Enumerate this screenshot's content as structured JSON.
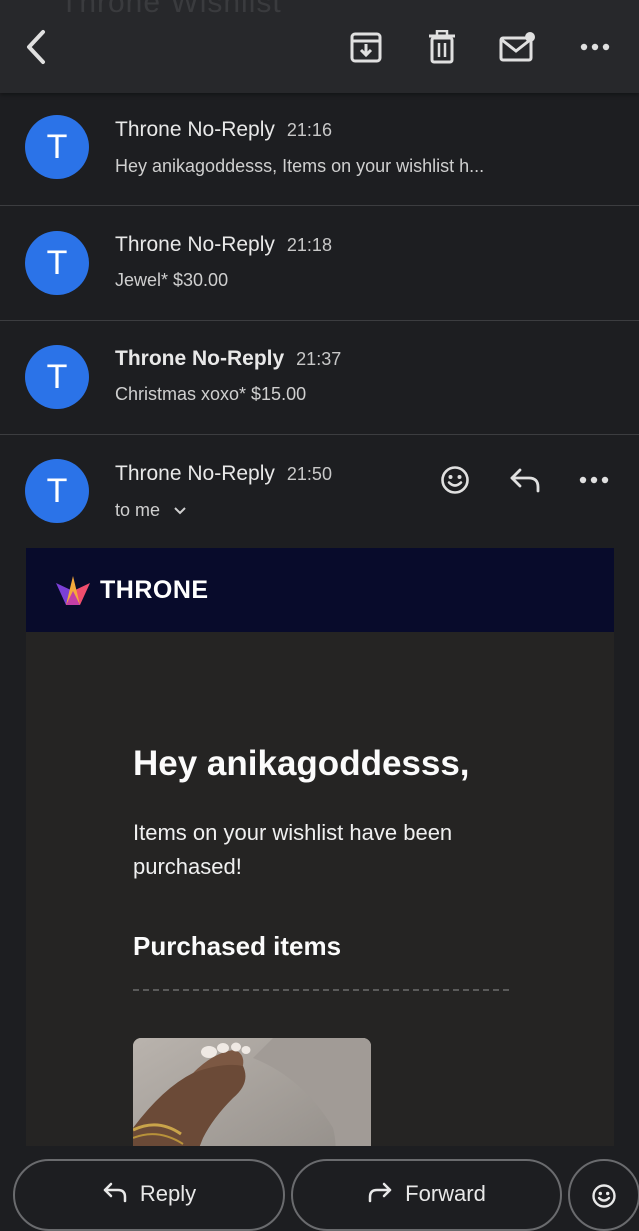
{
  "toolbar": {
    "ghost_text": "Throne Wishlist",
    "back_icon": "chevron-left-icon",
    "archive_icon": "archive-icon",
    "delete_icon": "trash-icon",
    "unread_icon": "mark-unread-icon",
    "more_icon": "more-horizontal-icon"
  },
  "threads": [
    {
      "initial": "T",
      "sender": "Throne No-Reply",
      "time": "21:16",
      "snippet": "Hey anikagoddesss, Items on your wishlist h...",
      "bold": false
    },
    {
      "initial": "T",
      "sender": "Throne No-Reply",
      "time": "21:18",
      "snippet": "Jewel* $30.00",
      "bold": false
    },
    {
      "initial": "T",
      "sender": "Throne No-Reply",
      "time": "21:37",
      "snippet": "Christmas xoxo* $15.00",
      "bold": true
    }
  ],
  "open_message": {
    "initial": "T",
    "sender": "Throne No-Reply",
    "time": "21:50",
    "recipient": "to me",
    "actions": [
      "emoji-reaction-icon",
      "reply-icon",
      "more-horizontal-icon"
    ]
  },
  "email": {
    "brand": "THRONE",
    "greeting": "Hey anikagoddesss,",
    "body": "Items on your wishlist have been purchased!",
    "section_title": "Purchased items"
  },
  "bottom_actions": {
    "reply_label": "Reply",
    "forward_label": "Forward"
  },
  "colors": {
    "background": "#1d1e21",
    "toolbar": "#27282b",
    "avatar": "#2b73e8",
    "email_header": "#080b2b",
    "email_body": "#252423"
  }
}
